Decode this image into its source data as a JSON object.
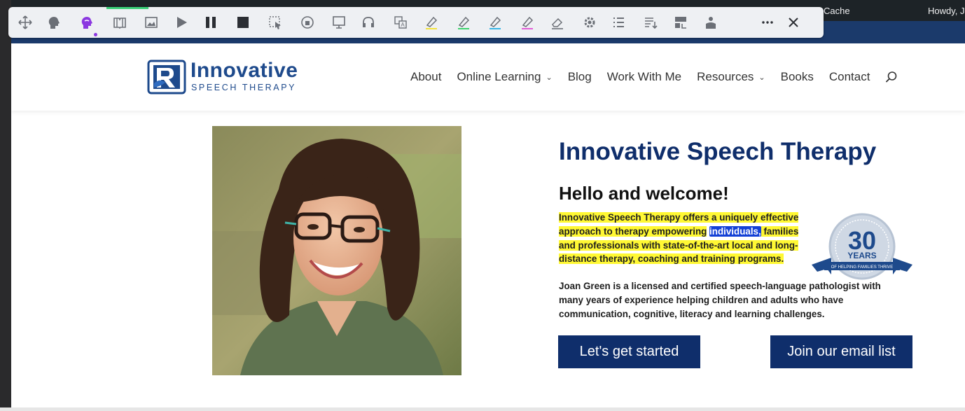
{
  "wp_admin_bar": {
    "cache_label": "Cache",
    "howdy_text": "Howdy, J"
  },
  "toolbar": {
    "buttons": [
      "move-icon",
      "head-profile-icon",
      "speech-head-icon",
      "book-icon",
      "image-icon",
      "play-icon",
      "pause-icon",
      "stop-icon",
      "select-region-icon",
      "audio-maker-icon",
      "screen-icon",
      "headphones-icon",
      "translate-icon",
      "highlight-yellow-icon",
      "highlight-green-icon",
      "highlight-blue-icon",
      "highlight-pink-icon",
      "eraser-icon",
      "settings-icon",
      "list-icon",
      "word-list-icon",
      "vocabulary-icon",
      "teacher-icon",
      "more-icon",
      "close-icon"
    ],
    "active_color": "#8b38e0"
  },
  "site": {
    "logo_name": "Innovative",
    "logo_subtitle": "SPEECH THERAPY",
    "nav": [
      {
        "label": "About",
        "has_menu": false
      },
      {
        "label": "Online Learning",
        "has_menu": true
      },
      {
        "label": "Blog",
        "has_menu": false
      },
      {
        "label": "Work With Me",
        "has_menu": false
      },
      {
        "label": "Resources",
        "has_menu": true
      },
      {
        "label": "Books",
        "has_menu": false
      },
      {
        "label": "Contact",
        "has_menu": false
      }
    ],
    "brand_color": "#0f2e6b"
  },
  "hero": {
    "title": "Innovative Speech Therapy",
    "greeting": "Hello and welcome!",
    "intro_before": "Innovative Speech Therapy offers a uniquely effective approach to therapy empowering",
    "intro_selected": "individuals,",
    "intro_after": "families and professionals with state-of-the-art local and long-distance therapy, coaching and training programs.",
    "bio": "Joan Green is a licensed and certified speech-language pathologist with many years of experience helping children and adults who have communication, cognitive, literacy and learning challenges.",
    "badge_number": "30",
    "badge_unit": "YEARS",
    "badge_ribbon": "OF HELPING FAMILIES THRIVE",
    "cta_primary": "Let's get started",
    "cta_secondary": "Join our email list"
  }
}
